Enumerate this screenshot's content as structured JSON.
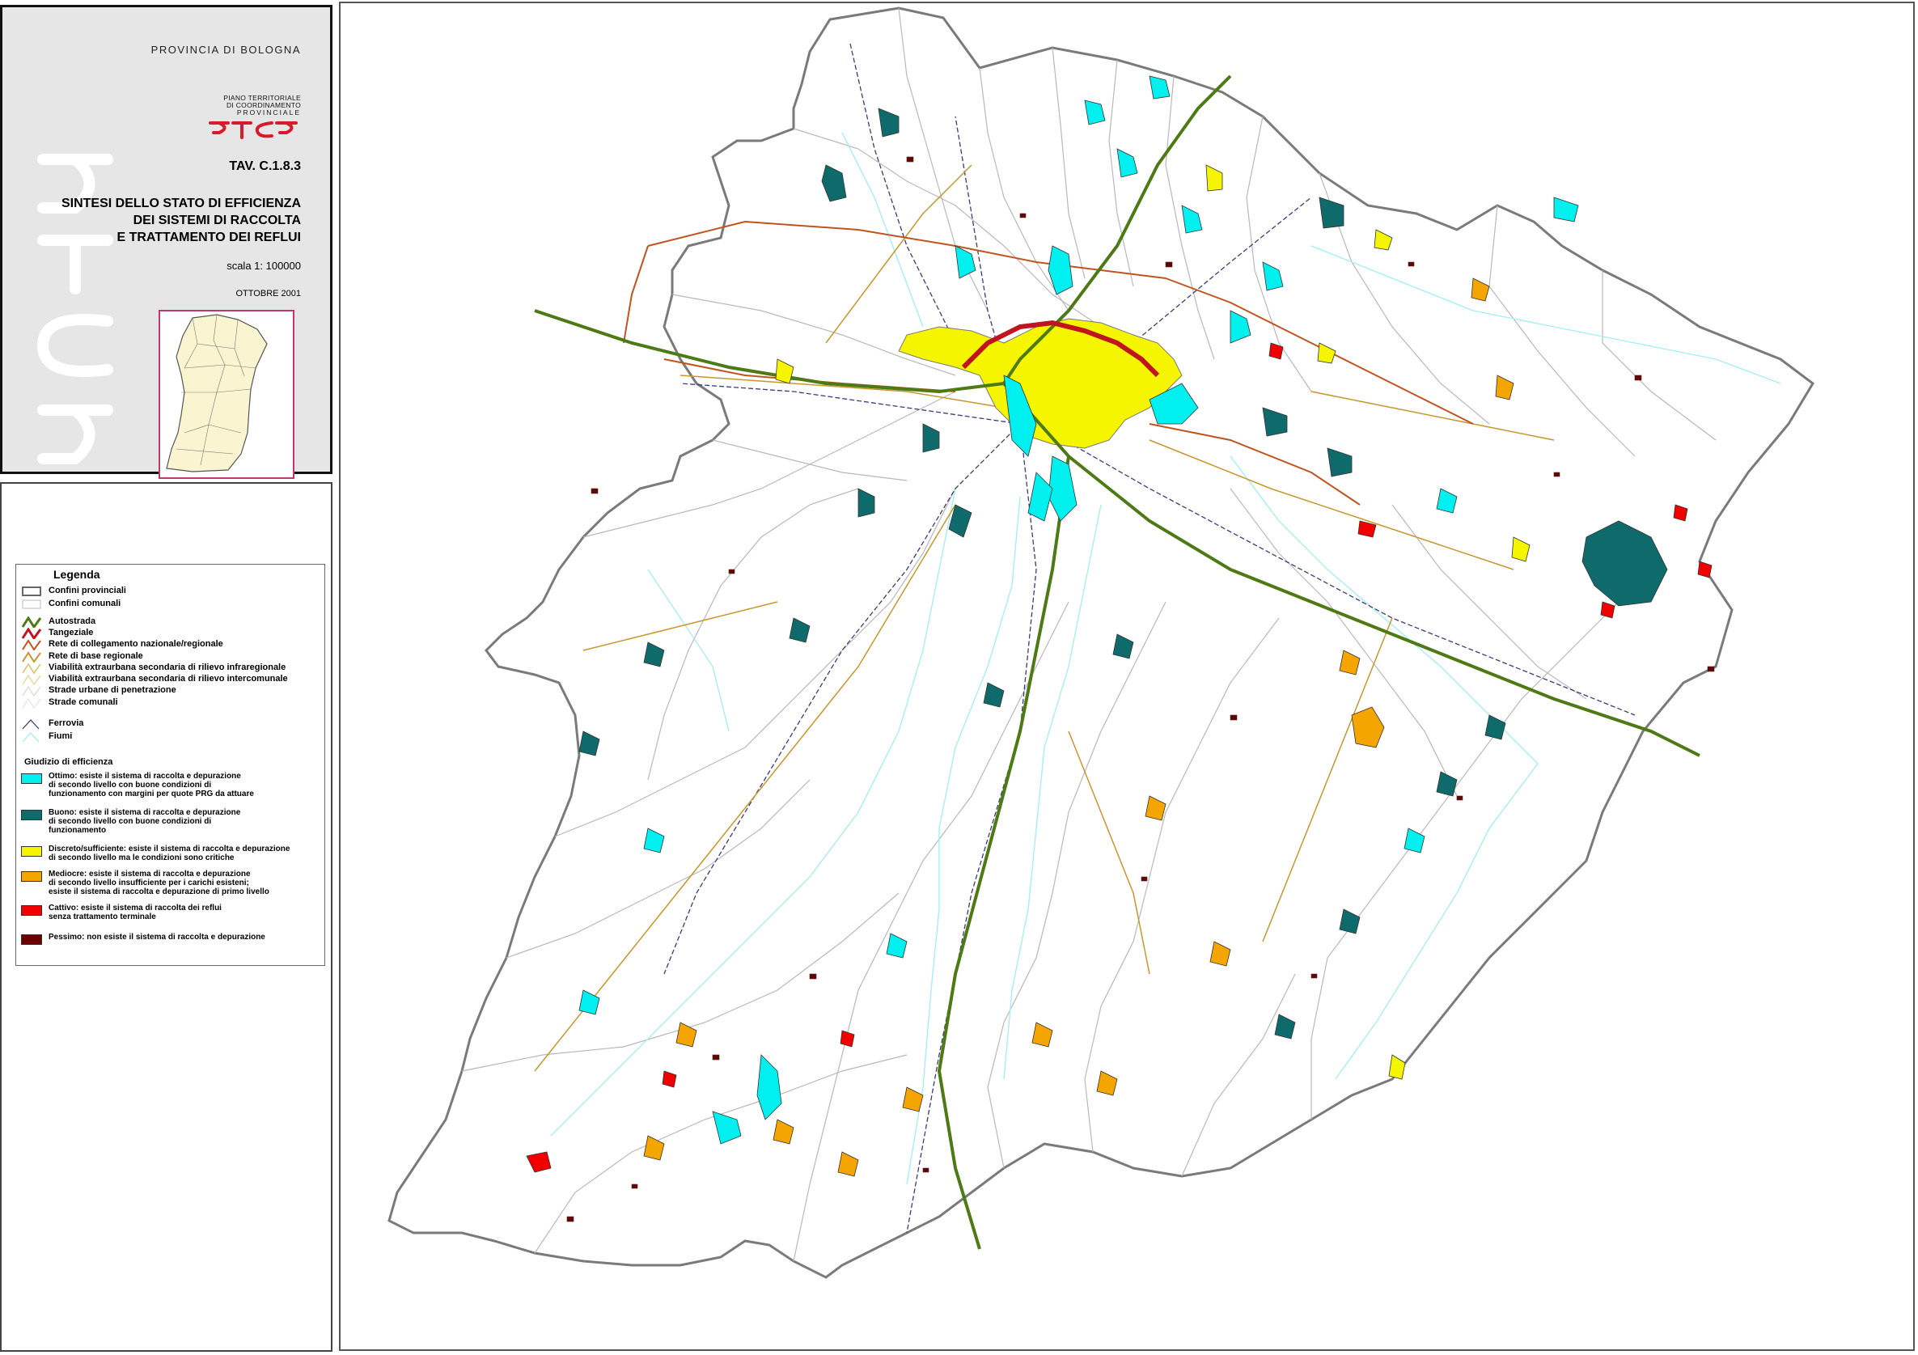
{
  "header": {
    "provincia": "PROVINCIA DI BOLOGNA",
    "logo_lines": [
      "PIANO TERRITORIALE",
      "DI COORDINAMENTO",
      "PROVINCIALE"
    ],
    "logo_text": "PTCP",
    "tavola": "TAV. C.1.8.3",
    "title_lines": [
      "SINTESI DELLO STATO DI EFFICIENZA",
      "DEI SISTEMI DI RACCOLTA",
      "E TRATTAMENTO DEI REFLUI"
    ],
    "scala": "scala 1: 100000",
    "data": "OTTOBRE 2001"
  },
  "legend": {
    "title": "Legenda",
    "items": [
      {
        "label": "Confini provinciali",
        "icon": "boundary-box",
        "color": "#666666"
      },
      {
        "label": "Confini comunali",
        "icon": "boundary-box",
        "color": "#bbbbbb"
      },
      {
        "label": "Autostrada",
        "icon": "zigzag",
        "color": "#4d7a14"
      },
      {
        "label": "Tangeziale",
        "icon": "zigzag",
        "color": "#c0141e"
      },
      {
        "label": "Rete di collegamento nazionale/regionale",
        "icon": "zigzag",
        "color": "#c0541e"
      },
      {
        "label": "Rete di base regionale",
        "icon": "zigzag",
        "color": "#c8962a"
      },
      {
        "label": "Viabilità extraurbana secondaria di rilievo infraregionale",
        "icon": "zigzag",
        "color": "#d9c066"
      },
      {
        "label": "Viabilità extraurbana secondaria di rilievo intercomunale",
        "icon": "zigzag",
        "color": "#eadb9a"
      },
      {
        "label": "Strade urbane di penetrazione",
        "icon": "zigzag",
        "color": "#e6e0c8"
      },
      {
        "label": "Strade comunali",
        "icon": "zigzag",
        "color": "#eeeeee"
      },
      {
        "label": "Ferrovia",
        "icon": "rail",
        "color": "#444488"
      },
      {
        "label": "Fiumi",
        "icon": "river",
        "color": "#9fe8f0"
      }
    ],
    "giudizio_title": "Giudizio di efficienza",
    "efficiency": [
      {
        "lines": [
          "Ottimo: esiste il sistema di raccolta e depurazione",
          "di secondo livello con buone condizioni di",
          "funzionamento con margini per quote PRG da attuare"
        ],
        "color": "#00f0f0"
      },
      {
        "lines": [
          "Buono: esiste il sistema di raccolta e depurazione",
          "di secondo livello con buone condizioni di",
          "funzionamento"
        ],
        "color": "#0f6b6b"
      },
      {
        "lines": [
          "Discreto/sufficiente: esiste il sistema di raccolta e depurazione",
          "di secondo livello ma le condizioni sono critiche"
        ],
        "color": "#f5f500"
      },
      {
        "lines": [
          "Mediocre: esiste il sistema di raccolta e depurazione",
          "di secondo livello insufficiente per i carichi esisteni;",
          "esiste il sistema di raccolta e depurazione di primo livello"
        ],
        "color": "#f5a500"
      },
      {
        "lines": [
          "Cattivo: esiste il sistema di raccolta dei reflui",
          "senza trattamento terminale"
        ],
        "color": "#f00000"
      },
      {
        "lines": [
          "Pessimo: non esiste il sistema di raccolta e depurazione"
        ],
        "color": "#6b0000"
      }
    ]
  },
  "map": {
    "colors": {
      "boundary": "#777777",
      "municipal": "#b8b8b8",
      "river": "#9fe8f0",
      "autostrada": "#4d7a14",
      "tangenziale": "#c0141e",
      "national": "#c0541e",
      "regional": "#c8962a",
      "rail": "#3a3a7a"
    }
  }
}
